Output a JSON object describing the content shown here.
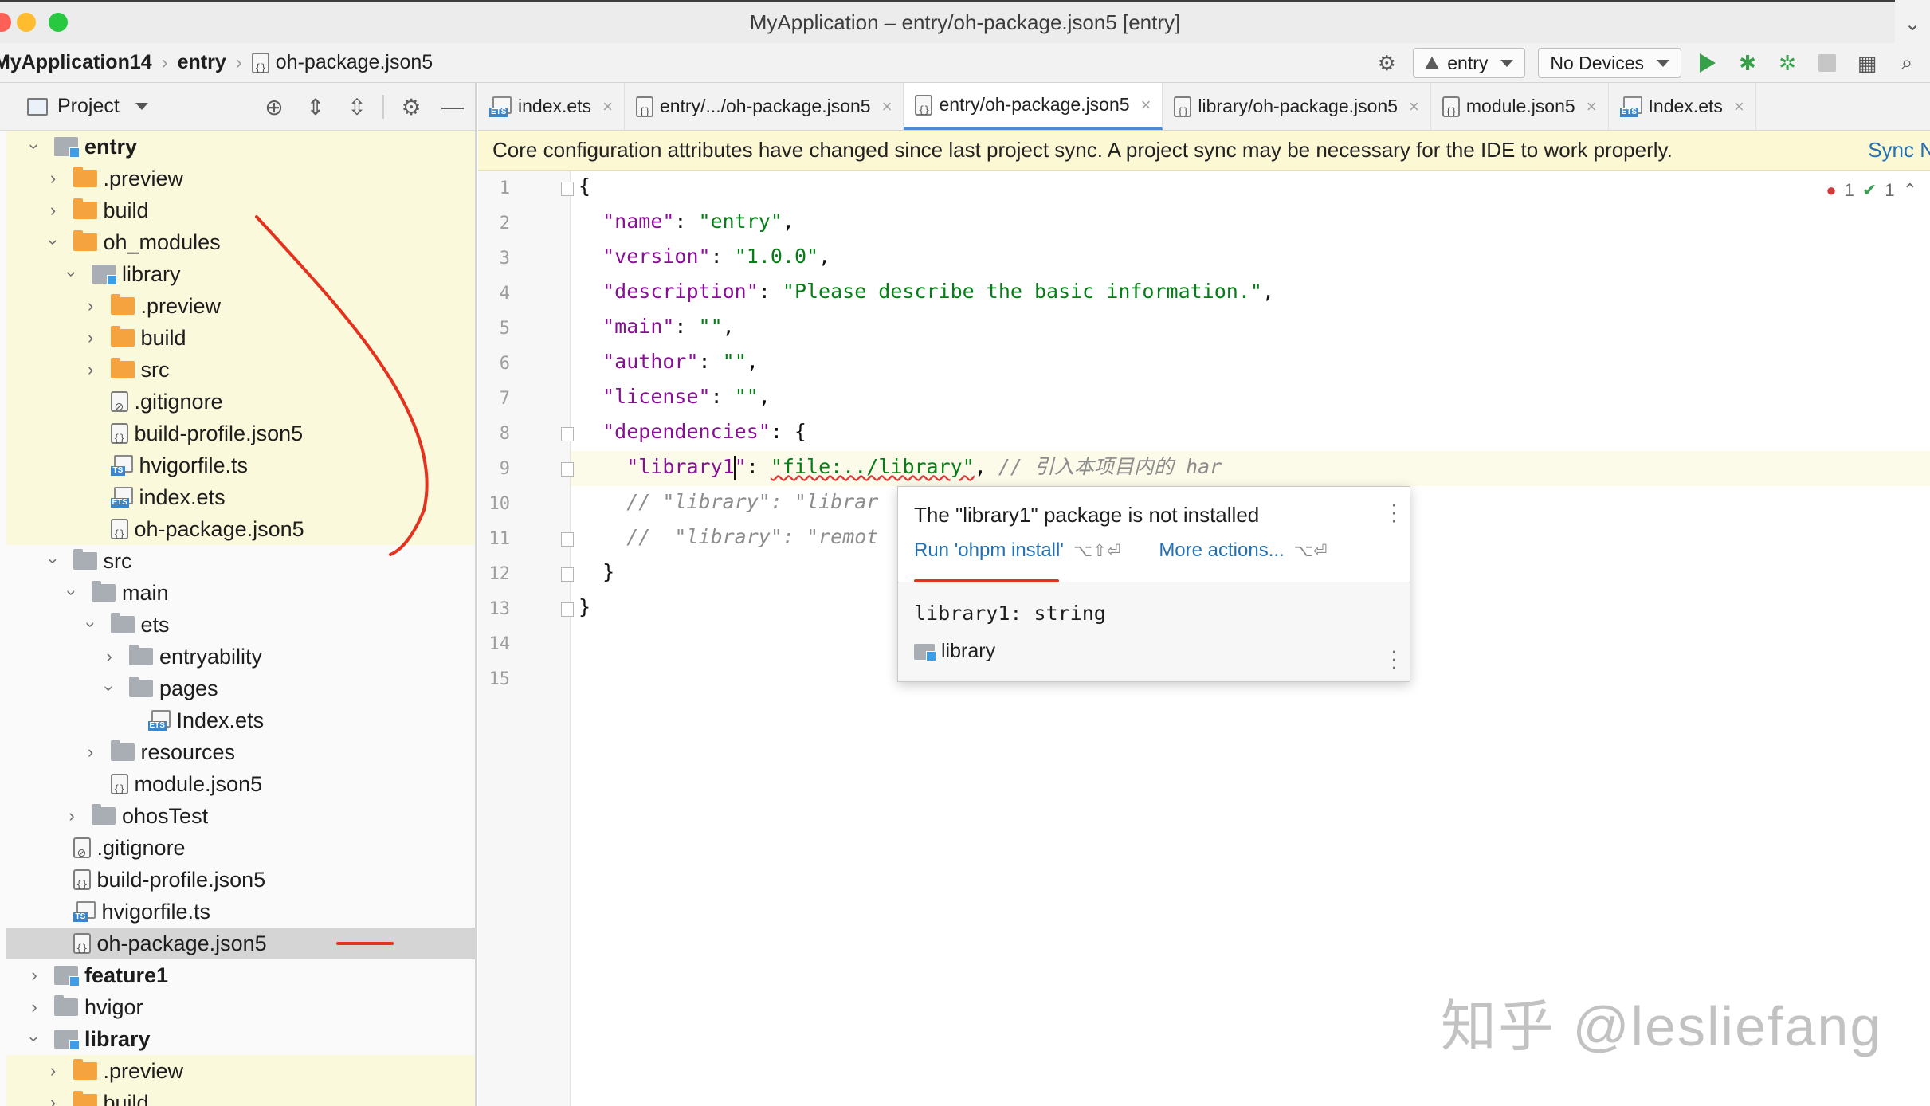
{
  "window": {
    "title": "MyApplication – entry/oh-package.json5 [entry]"
  },
  "breadcrumb": {
    "project": "MyApplication14",
    "module": "entry",
    "file": "oh-package.json5"
  },
  "toolbar": {
    "run_config": "entry",
    "device": "No Devices"
  },
  "project_panel": {
    "title": "Project",
    "tree": [
      {
        "label": "entry",
        "depth": 1,
        "arrow": "open",
        "icon": "module",
        "bold": true,
        "hl": true
      },
      {
        "label": ".preview",
        "depth": 2,
        "arrow": "closed",
        "icon": "folder-orange",
        "hl": true
      },
      {
        "label": "build",
        "depth": 2,
        "arrow": "closed",
        "icon": "folder-orange",
        "hl": true
      },
      {
        "label": "oh_modules",
        "depth": 2,
        "arrow": "open",
        "icon": "folder-orange",
        "hl": true
      },
      {
        "label": "library",
        "depth": 3,
        "arrow": "open",
        "icon": "module-link",
        "hl": true
      },
      {
        "label": ".preview",
        "depth": 4,
        "arrow": "closed",
        "icon": "folder-orange",
        "hl": true
      },
      {
        "label": "build",
        "depth": 4,
        "arrow": "closed",
        "icon": "folder-orange",
        "hl": true
      },
      {
        "label": "src",
        "depth": 4,
        "arrow": "closed",
        "icon": "folder-orange",
        "hl": true
      },
      {
        "label": ".gitignore",
        "depth": 4,
        "arrow": "none",
        "icon": "git",
        "hl": true
      },
      {
        "label": "build-profile.json5",
        "depth": 4,
        "arrow": "none",
        "icon": "json",
        "hl": true
      },
      {
        "label": "hvigorfile.ts",
        "depth": 4,
        "arrow": "none",
        "icon": "ts",
        "hl": true
      },
      {
        "label": "index.ets",
        "depth": 4,
        "arrow": "none",
        "icon": "ets",
        "hl": true
      },
      {
        "label": "oh-package.json5",
        "depth": 4,
        "arrow": "none",
        "icon": "json",
        "hl": true
      },
      {
        "label": "src",
        "depth": 2,
        "arrow": "open",
        "icon": "folder-grey"
      },
      {
        "label": "main",
        "depth": 3,
        "arrow": "open",
        "icon": "folder-grey"
      },
      {
        "label": "ets",
        "depth": 4,
        "arrow": "open",
        "icon": "folder-grey"
      },
      {
        "label": "entryability",
        "depth": 5,
        "arrow": "closed",
        "icon": "folder-grey"
      },
      {
        "label": "pages",
        "depth": 5,
        "arrow": "open",
        "icon": "folder-grey"
      },
      {
        "label": "Index.ets",
        "depth": 6,
        "arrow": "none",
        "icon": "ets"
      },
      {
        "label": "resources",
        "depth": 4,
        "arrow": "closed",
        "icon": "folder-grey"
      },
      {
        "label": "module.json5",
        "depth": 4,
        "arrow": "none",
        "icon": "json"
      },
      {
        "label": "ohosTest",
        "depth": 3,
        "arrow": "closed",
        "icon": "folder-grey"
      },
      {
        "label": ".gitignore",
        "depth": 2,
        "arrow": "none",
        "icon": "git"
      },
      {
        "label": "build-profile.json5",
        "depth": 2,
        "arrow": "none",
        "icon": "json"
      },
      {
        "label": "hvigorfile.ts",
        "depth": 2,
        "arrow": "none",
        "icon": "ts"
      },
      {
        "label": "oh-package.json5",
        "depth": 2,
        "arrow": "none",
        "icon": "json",
        "selected": true
      },
      {
        "label": "feature1",
        "depth": 1,
        "arrow": "closed",
        "icon": "module",
        "bold": true
      },
      {
        "label": "hvigor",
        "depth": 1,
        "arrow": "closed",
        "icon": "folder-grey"
      },
      {
        "label": "library",
        "depth": 1,
        "arrow": "open",
        "icon": "module",
        "bold": true
      },
      {
        "label": ".preview",
        "depth": 2,
        "arrow": "closed",
        "icon": "folder-orange",
        "hl": true
      },
      {
        "label": "build",
        "depth": 2,
        "arrow": "closed",
        "icon": "folder-orange",
        "hl": true
      }
    ]
  },
  "tabs": [
    {
      "label": "index.ets",
      "icon": "ets"
    },
    {
      "label": "entry/.../oh-package.json5",
      "icon": "json"
    },
    {
      "label": "entry/oh-package.json5",
      "icon": "json",
      "active": true
    },
    {
      "label": "library/oh-package.json5",
      "icon": "json"
    },
    {
      "label": "module.json5",
      "icon": "json"
    },
    {
      "label": "Index.ets",
      "icon": "ets"
    }
  ],
  "banner": {
    "text": "Core configuration attributes have changed since last project sync. A project sync may be necessary for the IDE to work properly.",
    "link": "Sync N"
  },
  "editor": {
    "line_numbers": [
      "1",
      "2",
      "3",
      "4",
      "5",
      "6",
      "7",
      "8",
      "9",
      "10",
      "11",
      "12",
      "13",
      "14",
      "15"
    ],
    "errors": "1",
    "warnings": "1",
    "lines": [
      {
        "parts": [
          {
            "t": "p",
            "v": "{"
          }
        ]
      },
      {
        "parts": [
          {
            "t": "p",
            "v": "  "
          },
          {
            "t": "k",
            "v": "\"name\""
          },
          {
            "t": "p",
            "v": ": "
          },
          {
            "t": "s",
            "v": "\"entry\""
          },
          {
            "t": "p",
            "v": ","
          }
        ]
      },
      {
        "parts": [
          {
            "t": "p",
            "v": "  "
          },
          {
            "t": "k",
            "v": "\"version\""
          },
          {
            "t": "p",
            "v": ": "
          },
          {
            "t": "s",
            "v": "\"1.0.0\""
          },
          {
            "t": "p",
            "v": ","
          }
        ]
      },
      {
        "parts": [
          {
            "t": "p",
            "v": "  "
          },
          {
            "t": "k",
            "v": "\"description\""
          },
          {
            "t": "p",
            "v": ": "
          },
          {
            "t": "s",
            "v": "\"Please describe the basic information.\""
          },
          {
            "t": "p",
            "v": ","
          }
        ]
      },
      {
        "parts": [
          {
            "t": "p",
            "v": "  "
          },
          {
            "t": "k",
            "v": "\"main\""
          },
          {
            "t": "p",
            "v": ": "
          },
          {
            "t": "s",
            "v": "\"\""
          },
          {
            "t": "p",
            "v": ","
          }
        ]
      },
      {
        "parts": [
          {
            "t": "p",
            "v": "  "
          },
          {
            "t": "k",
            "v": "\"author\""
          },
          {
            "t": "p",
            "v": ": "
          },
          {
            "t": "s",
            "v": "\"\""
          },
          {
            "t": "p",
            "v": ","
          }
        ]
      },
      {
        "parts": [
          {
            "t": "p",
            "v": "  "
          },
          {
            "t": "k",
            "v": "\"license\""
          },
          {
            "t": "p",
            "v": ": "
          },
          {
            "t": "s",
            "v": "\"\""
          },
          {
            "t": "p",
            "v": ","
          }
        ]
      },
      {
        "parts": [
          {
            "t": "p",
            "v": "  "
          },
          {
            "t": "k",
            "v": "\"dependencies\""
          },
          {
            "t": "p",
            "v": ": {"
          }
        ]
      },
      {
        "parts": [
          {
            "t": "p",
            "v": "    "
          },
          {
            "t": "k",
            "v": "\"library"
          },
          {
            "t": "r",
            "v": "1"
          },
          {
            "t": "caret",
            "v": ""
          },
          {
            "t": "k",
            "v": "\""
          },
          {
            "t": "p",
            "v": ": "
          },
          {
            "t": "se",
            "v": "\"file:../library\""
          },
          {
            "t": "p",
            "v": ", "
          },
          {
            "t": "c",
            "v": "// 引入本项目内的 har"
          }
        ]
      },
      {
        "parts": [
          {
            "t": "p",
            "v": "    "
          },
          {
            "t": "c",
            "v": "// \"library\": \"librar"
          }
        ]
      },
      {
        "parts": [
          {
            "t": "p",
            "v": "    "
          },
          {
            "t": "c",
            "v": "//  \"library\": \"remot"
          }
        ]
      },
      {
        "parts": [
          {
            "t": "p",
            "v": "  }"
          }
        ]
      },
      {
        "parts": [
          {
            "t": "p",
            "v": "}"
          }
        ]
      },
      {
        "parts": []
      },
      {
        "parts": []
      }
    ]
  },
  "popup": {
    "message": "The \"library1\" package is not installed",
    "action_primary": "Run 'ohpm install'",
    "action_primary_kbd": "⌥⇧⏎",
    "action_secondary": "More actions...",
    "action_secondary_kbd": "⌥⏎",
    "signature": "library1: string",
    "module": "library"
  },
  "watermark": "知乎 @lesliefang",
  "colors": {
    "accent": "#4a8bd4",
    "annotation_red": "#e4321e",
    "banner_bg": "#fdf8d4",
    "json_key": "#871094",
    "json_string": "#067d17"
  }
}
